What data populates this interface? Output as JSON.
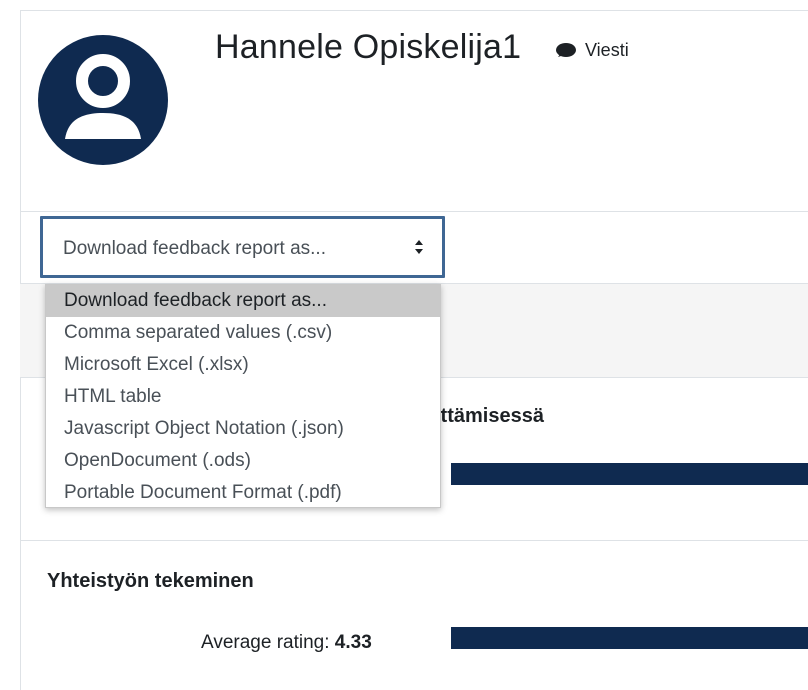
{
  "profile": {
    "name": "Hannele Opiskelija1",
    "message_label": "Viesti",
    "avatar_icon": "user-avatar-icon",
    "message_icon": "speech-bubble-icon"
  },
  "download": {
    "selected": "Download feedback report as...",
    "options": [
      "Download feedback report as...",
      "Comma separated values (.csv)",
      "Microsoft Excel (.xlsx)",
      "HTML table",
      "Javascript Object Notation (.json)",
      "OpenDocument (.ods)",
      "Portable Document Format (.pdf)"
    ]
  },
  "questions": [
    {
      "title_visible": "ittämisessä"
    },
    {
      "title": "Yhteistyön tekeminen",
      "average_label": "Average rating:",
      "average_value": "4.33"
    }
  ],
  "colors": {
    "brand_dark": "#0f2a50",
    "focus_border": "#3f6794"
  }
}
